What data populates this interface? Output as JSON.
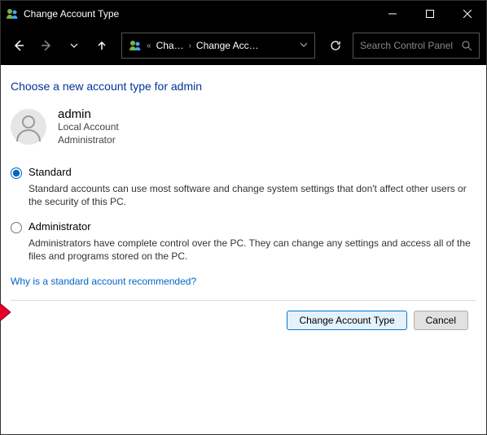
{
  "window": {
    "title": "Change Account Type"
  },
  "address": {
    "crumb1": "Cha…",
    "crumb2": "Change Acc…"
  },
  "search": {
    "placeholder": "Search Control Panel"
  },
  "page": {
    "heading": "Choose a new account type for admin",
    "user": {
      "name": "admin",
      "line1": "Local Account",
      "line2": "Administrator"
    },
    "options": {
      "standard": {
        "label": "Standard",
        "desc": "Standard accounts can use most software and change system settings that don't affect other users or the security of this PC."
      },
      "admin": {
        "label": "Administrator",
        "desc": "Administrators have complete control over the PC. They can change any settings and access all of the files and programs stored on the PC."
      }
    },
    "link": "Why is a standard account recommended?",
    "buttons": {
      "change": "Change Account Type",
      "cancel": "Cancel"
    }
  }
}
